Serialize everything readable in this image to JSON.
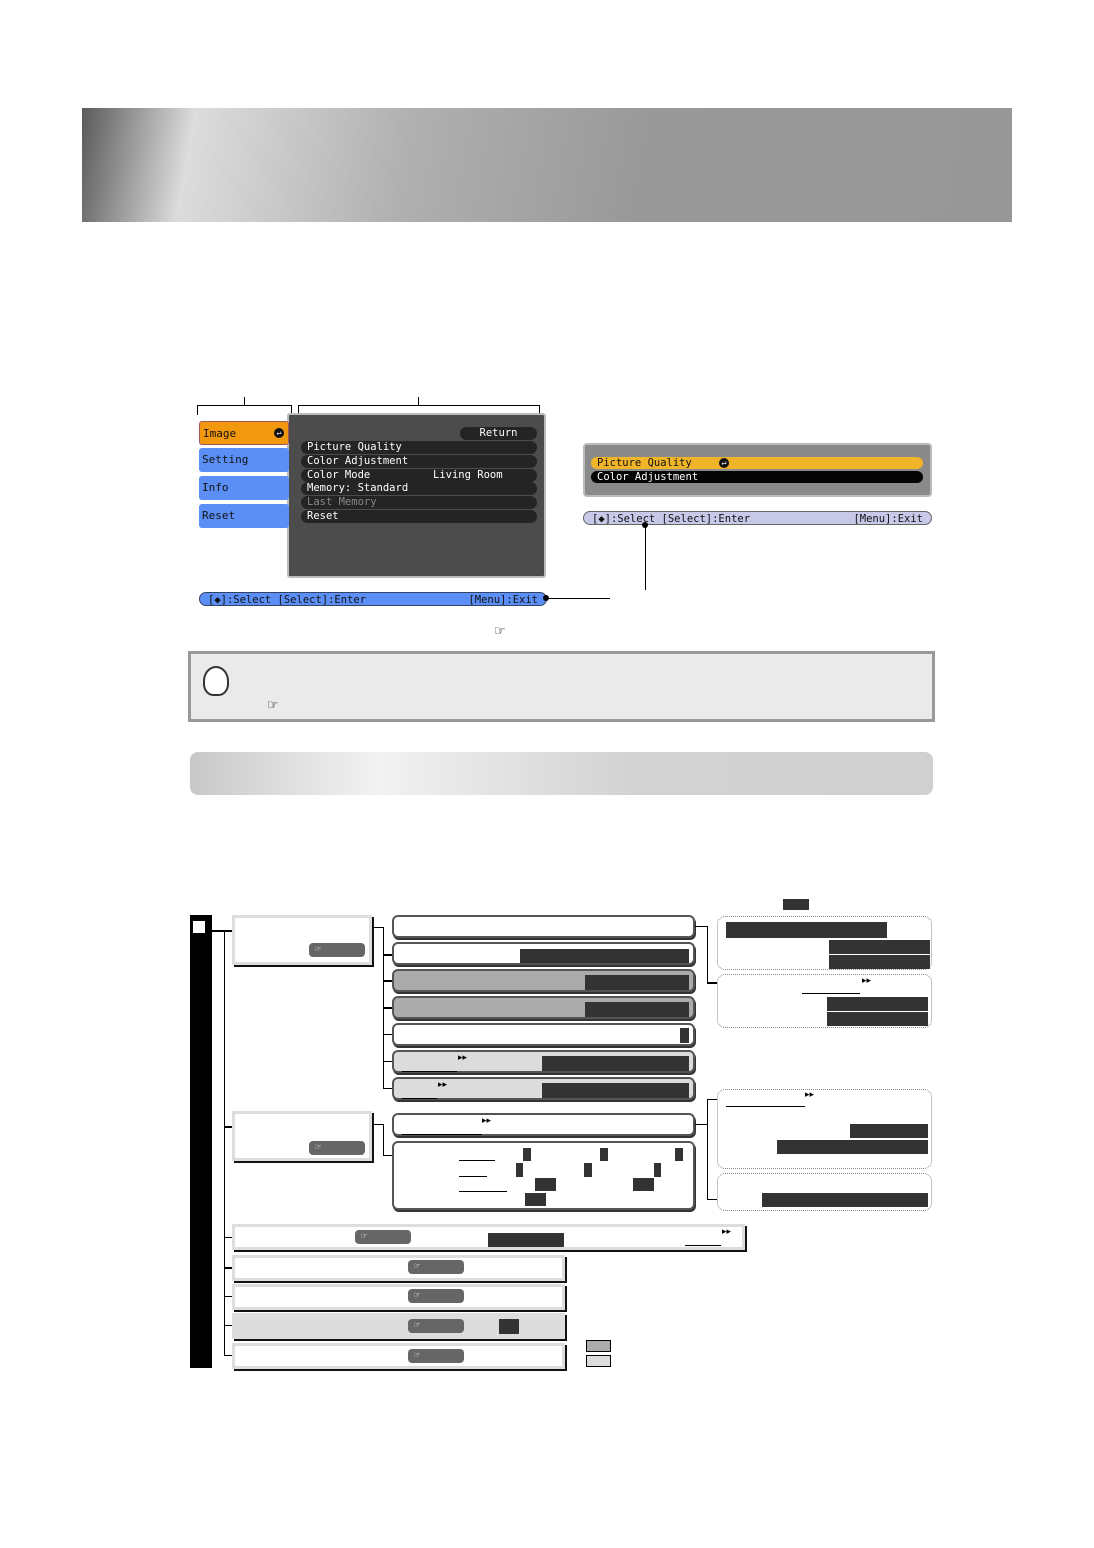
{
  "menu": {
    "tabs": [
      {
        "label": "Image",
        "active": true
      },
      {
        "label": "Setting"
      },
      {
        "label": "Info"
      },
      {
        "label": "Reset"
      }
    ],
    "return_label": "Return",
    "rows": [
      {
        "label": "Picture Quality",
        "value": ""
      },
      {
        "label": "Color Adjustment",
        "value": ""
      },
      {
        "label": "Color Mode",
        "value": "Living Room"
      },
      {
        "label": "Memory: Standard",
        "value": ""
      },
      {
        "label": "Last Memory",
        "value": "",
        "disabled": true
      },
      {
        "label": "Reset",
        "value": ""
      }
    ],
    "footer_left": "[◆]:Select [Select]:Enter",
    "footer_right": "[Menu]:Exit"
  },
  "submenu": {
    "rows": [
      "Picture Quality",
      "Color Adjustment"
    ],
    "footer_left": "[◆]:Select [Select]:Enter",
    "footer_right": "[Menu]:Exit"
  },
  "colors": {
    "active_tab": "#f2980e",
    "tab": "#5b8ff5",
    "footer_main": "#5b8ff5",
    "footer_sub": "#c8c8e8",
    "highlight": "#f0b429"
  },
  "icons": {
    "enter": "enter-icon",
    "pointer": "pointing-hand-icon",
    "tip": "lightbulb-icon",
    "forward": "double-arrow-icon"
  }
}
